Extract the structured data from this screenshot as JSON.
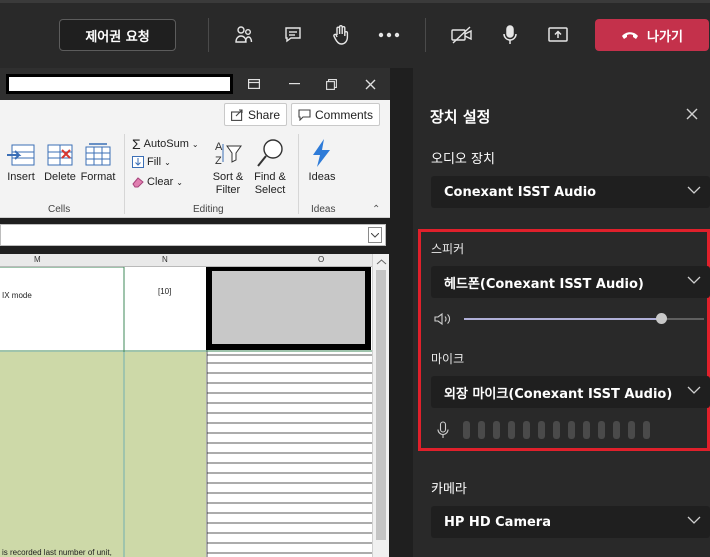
{
  "toolbar": {
    "control_request_label": "제어권 요청",
    "leave_label": "나가기",
    "icons": [
      "people-icon",
      "chat-icon",
      "raise-hand-icon",
      "more-icon",
      "camera-off-icon",
      "mic-icon",
      "share-screen-icon",
      "hangup-icon"
    ],
    "leave_color": "#c4314b"
  },
  "excel": {
    "ribbon": {
      "share_label": "Share",
      "comments_label": "Comments",
      "insert_label": "Insert",
      "delete_label": "Delete",
      "format_label": "Format",
      "cells_group": "Cells",
      "autosum_label": "AutoSum",
      "fill_label": "Fill",
      "clear_label": "Clear",
      "sort_label": "Sort &\nFilter",
      "find_label": "Find &\nSelect",
      "editing_group": "Editing",
      "ideas_label": "Ideas",
      "ideas_group": "Ideas"
    },
    "columns": [
      "M",
      "N",
      "O"
    ],
    "cells": {
      "m_text": "IX mode",
      "n_text": "[10]",
      "bottom_text": "is recorded last number of unit,"
    },
    "green_fill": "#cdd9a8"
  },
  "panel": {
    "title": "장치 설정",
    "audio_label": "오디오 장치",
    "audio_device": "Conexant ISST Audio",
    "speaker_label": "스피커",
    "speaker_device": "헤드폰(Conexant ISST Audio)",
    "speaker_volume_pct": 82,
    "mic_label": "마이크",
    "mic_device": "외장 마이크(Conexant ISST Audio)",
    "mic_level_bars": 13,
    "camera_label": "카메라",
    "camera_device": "HP HD Camera",
    "highlight_color": "#e0202b"
  }
}
